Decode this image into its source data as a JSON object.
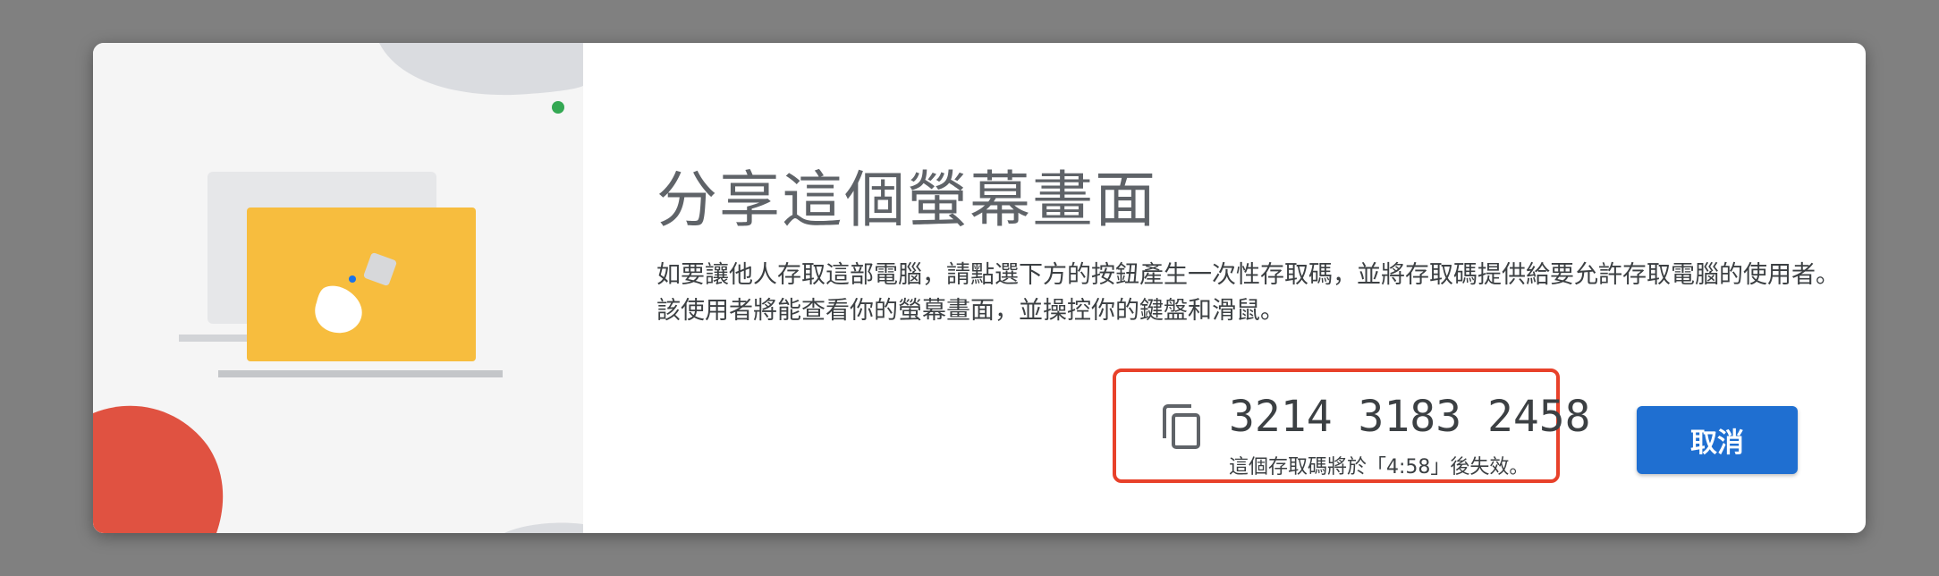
{
  "dialog": {
    "title": "分享這個螢幕畫面",
    "description": "如要讓他人存取這部電腦，請點選下方的按鈕產生一次性存取碼，並將存取碼提供給要允許存取電腦的使用者。該使用者將能查看你的螢幕畫面，並操控你的鍵盤和滑鼠。",
    "access_code": "3214 3183 2458",
    "expiry_text": "這個存取碼將於「4:58」後失效。",
    "cancel_label": "取消"
  },
  "icons": {
    "copy": "copy-icon",
    "illustration": "laptop-illustration"
  },
  "colors": {
    "accent_blue": "#1f6fd1",
    "highlight_red": "#e8412a",
    "illustration_yellow": "#f7bd3e",
    "illustration_red": "#e05241",
    "status_green": "#34a853"
  }
}
